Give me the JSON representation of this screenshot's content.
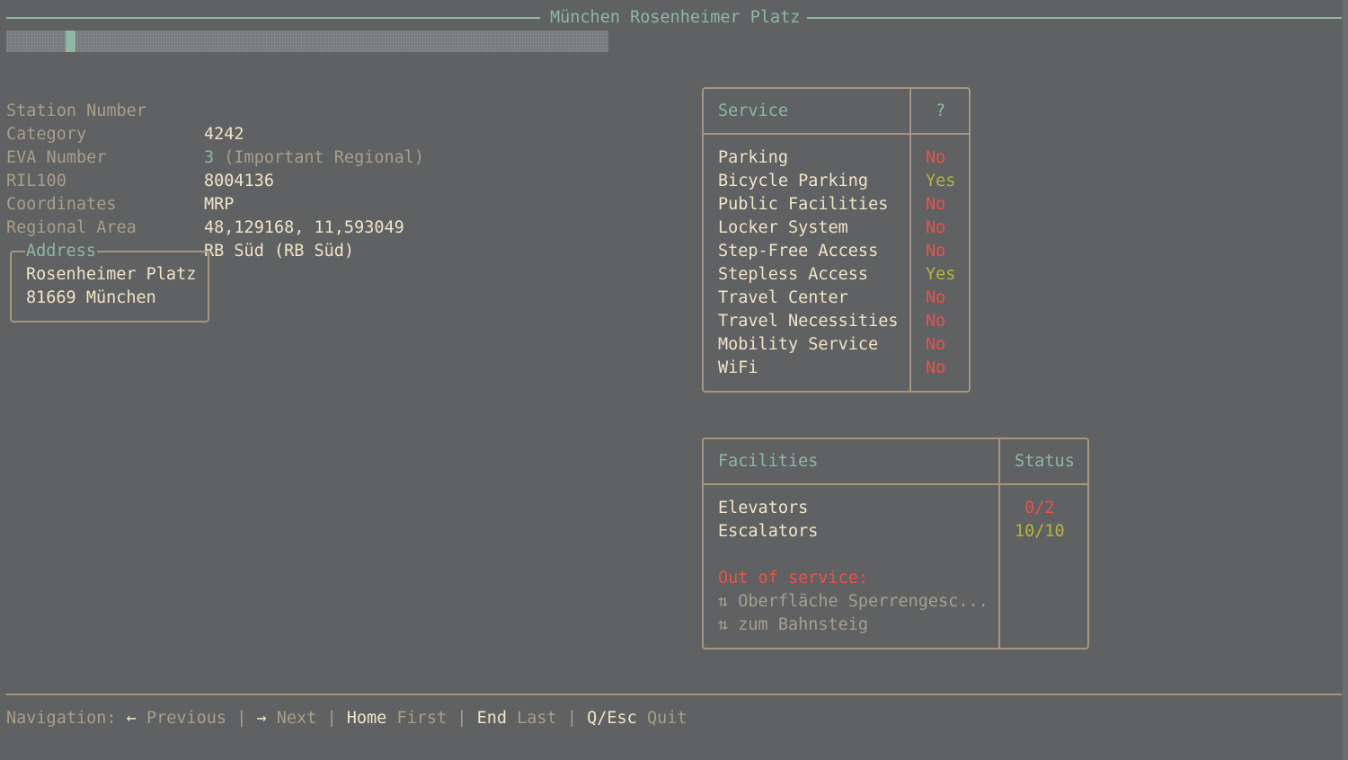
{
  "title": "München Rosenheimer Platz",
  "progress": {
    "fraction": 0.1
  },
  "info": [
    {
      "label": "Station Number",
      "value": "4242"
    },
    {
      "label": "Category",
      "value_num": "3",
      "value_desc": "(Important Regional)"
    },
    {
      "label": "EVA Number",
      "value": "8004136"
    },
    {
      "label": "RIL100",
      "value": "MRP"
    },
    {
      "label": "Coordinates",
      "value": "48,129168, 11,593049"
    },
    {
      "label": "Regional Area",
      "value": "RB Süd (RB Süd)"
    }
  ],
  "address": {
    "legend": "Address",
    "line1": "Rosenheimer Platz",
    "line2": "81669 München"
  },
  "services": {
    "header_name": "Service",
    "header_value": "?",
    "rows": [
      {
        "name": "Parking",
        "value": "No"
      },
      {
        "name": "Bicycle Parking",
        "value": "Yes"
      },
      {
        "name": "Public Facilities",
        "value": "No"
      },
      {
        "name": "Locker System",
        "value": "No"
      },
      {
        "name": "Step-Free Access",
        "value": "No"
      },
      {
        "name": "Stepless Access",
        "value": "Yes"
      },
      {
        "name": "Travel Center",
        "value": "No"
      },
      {
        "name": "Travel Necessities",
        "value": "No"
      },
      {
        "name": "Mobility Service",
        "value": "No"
      },
      {
        "name": "WiFi",
        "value": "No"
      }
    ]
  },
  "facilities": {
    "header_name": "Facilities",
    "header_status": "Status",
    "rows": [
      {
        "name": "Elevators",
        "status": "0/2"
      },
      {
        "name": "Escalators",
        "status": "10/10"
      }
    ],
    "out_of_service_label": "Out of service:",
    "out_of_service": [
      {
        "icon": "⇅",
        "text": "Oberfläche Sperrengesc..."
      },
      {
        "icon": "⇅",
        "text": "zum Bahnsteig"
      }
    ]
  },
  "navigation": {
    "label": "Navigation:",
    "prev_key": "←",
    "prev_label": "Previous",
    "next_key": "→",
    "next_label": "Next",
    "home_key": "Home",
    "home_label": "First",
    "end_key": "End",
    "end_label": "Last",
    "quit_key": "Q/Esc",
    "quit_label": "Quit",
    "separator": "|"
  },
  "colors": {
    "background": "#5f6163",
    "accent": "#8db8a2",
    "yes": "#b5b53a",
    "no": "#e8524a",
    "border": "#a69680"
  }
}
